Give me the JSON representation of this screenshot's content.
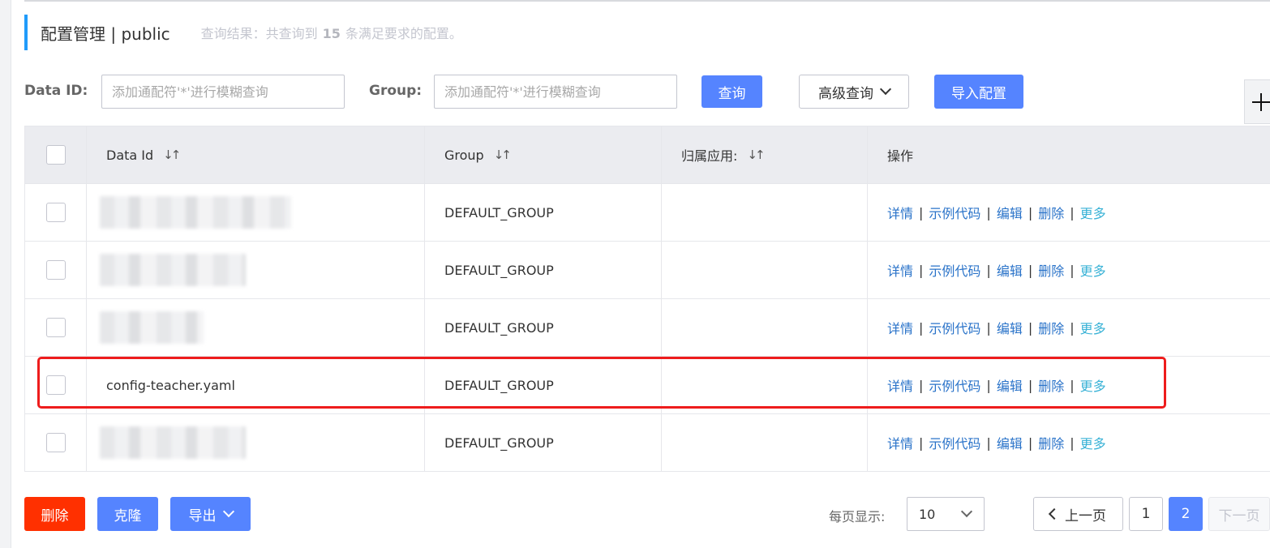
{
  "header": {
    "title": "配置管理 | public",
    "result_prefix": "查询结果：共查询到",
    "result_count": "15",
    "result_suffix": "条满足要求的配置。"
  },
  "search": {
    "data_id_label": "Data ID:",
    "data_id_placeholder": "添加通配符'*'进行模糊查询",
    "group_label": "Group:",
    "group_placeholder": "添加通配符'*'进行模糊查询",
    "query_button": "查询",
    "advanced_button": "高级查询",
    "import_button": "导入配置"
  },
  "table": {
    "columns": [
      "Data Id",
      "Group",
      "归属应用:",
      "操作"
    ],
    "rows": [
      {
        "data_id": "",
        "group": "DEFAULT_GROUP",
        "app": ""
      },
      {
        "data_id": "",
        "group": "DEFAULT_GROUP",
        "app": ""
      },
      {
        "data_id": "",
        "group": "DEFAULT_GROUP",
        "app": ""
      },
      {
        "data_id": "config-teacher.yaml",
        "group": "DEFAULT_GROUP",
        "app": ""
      },
      {
        "data_id": "",
        "group": "DEFAULT_GROUP",
        "app": ""
      }
    ],
    "operations": {
      "detail": "详情",
      "sample_code": "示例代码",
      "edit": "编辑",
      "delete": "删除",
      "more": "更多",
      "separator": "|"
    }
  },
  "footer": {
    "delete_button": "删除",
    "clone_button": "克隆",
    "export_button": "导出",
    "page_size_label": "每页显示:",
    "page_size_value": "10",
    "prev_button": "上一页",
    "pages": [
      "1",
      "2"
    ],
    "current_page": "2",
    "next_button": "下一页"
  },
  "colors": {
    "accent": "#209bfa",
    "primary": "#5584ff",
    "danger": "#ff3000",
    "link": "#2a73c9",
    "highlight": "#ee1c1c"
  }
}
